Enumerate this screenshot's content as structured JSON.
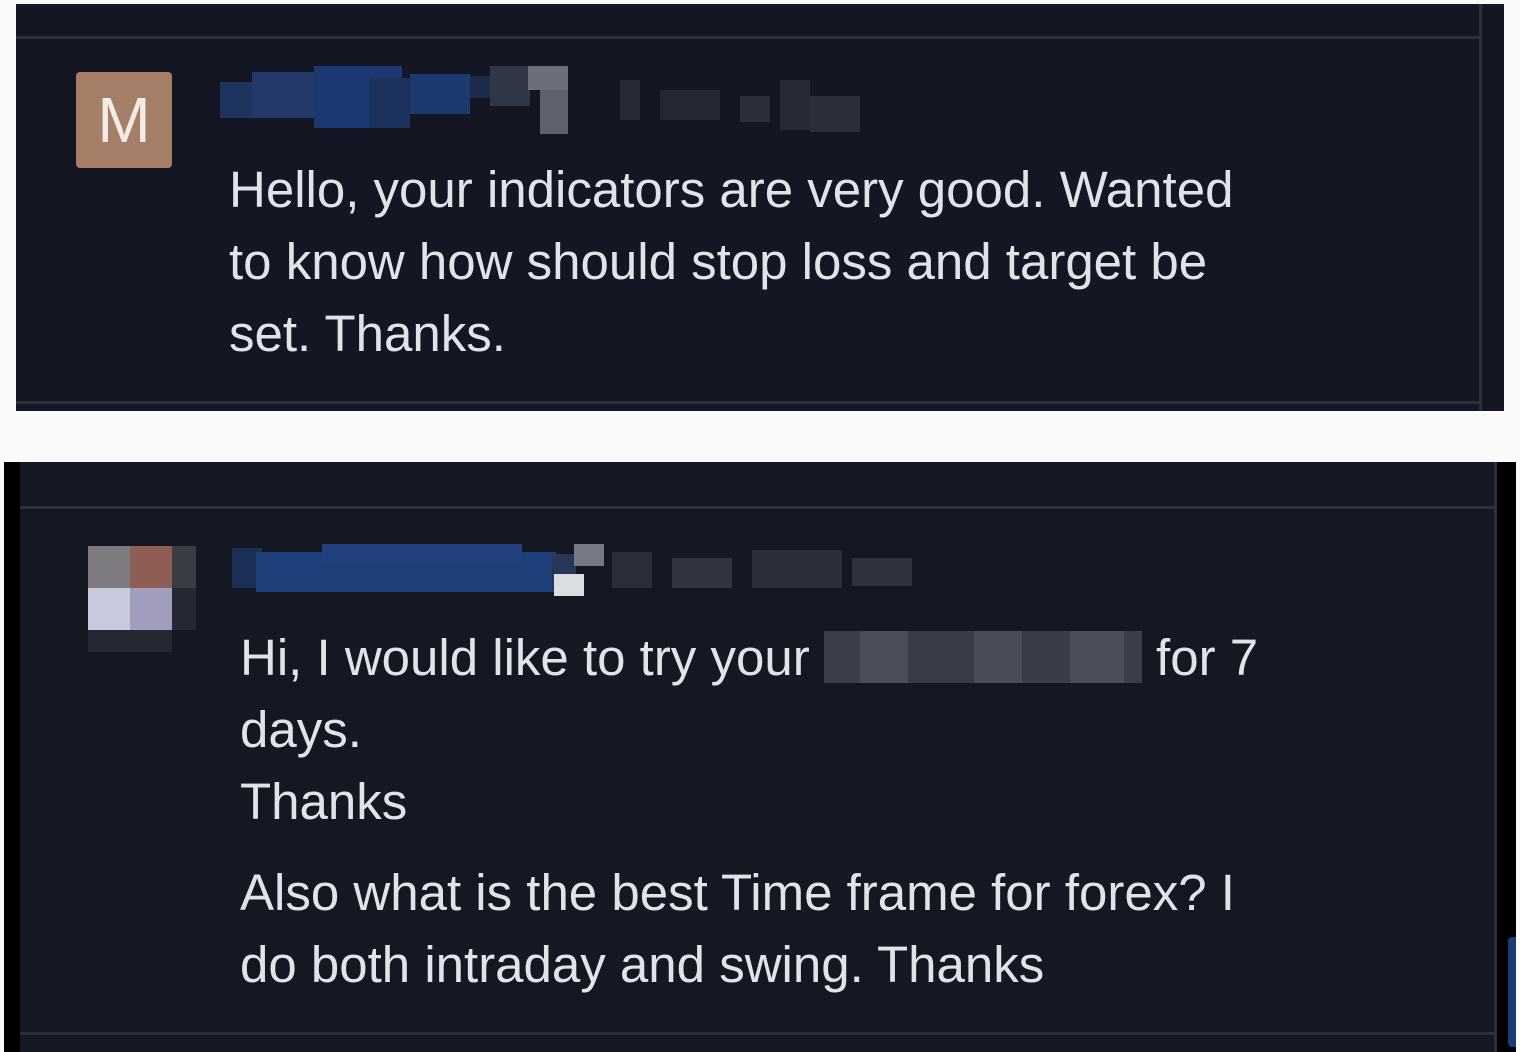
{
  "comments": [
    {
      "avatar_letter": "M",
      "avatar_color": "#a47e67",
      "username": "",
      "text": "Hello, your indicators are very good. Wanted\nto know how should stop loss and target be\nset. Thanks."
    },
    {
      "username": "",
      "text_before_redaction": "Hi, I would like to try your ",
      "text_after_redaction": " for 7\ndays.\nThanks",
      "text_followup": "Also what is the best Time frame for forex? I\ndo both intraday and swing. Thanks"
    }
  ],
  "colors": {
    "panel_background": "#151823",
    "text": "#dfe3ea",
    "divider": "#2c303d",
    "page_background": "#fafafa"
  }
}
